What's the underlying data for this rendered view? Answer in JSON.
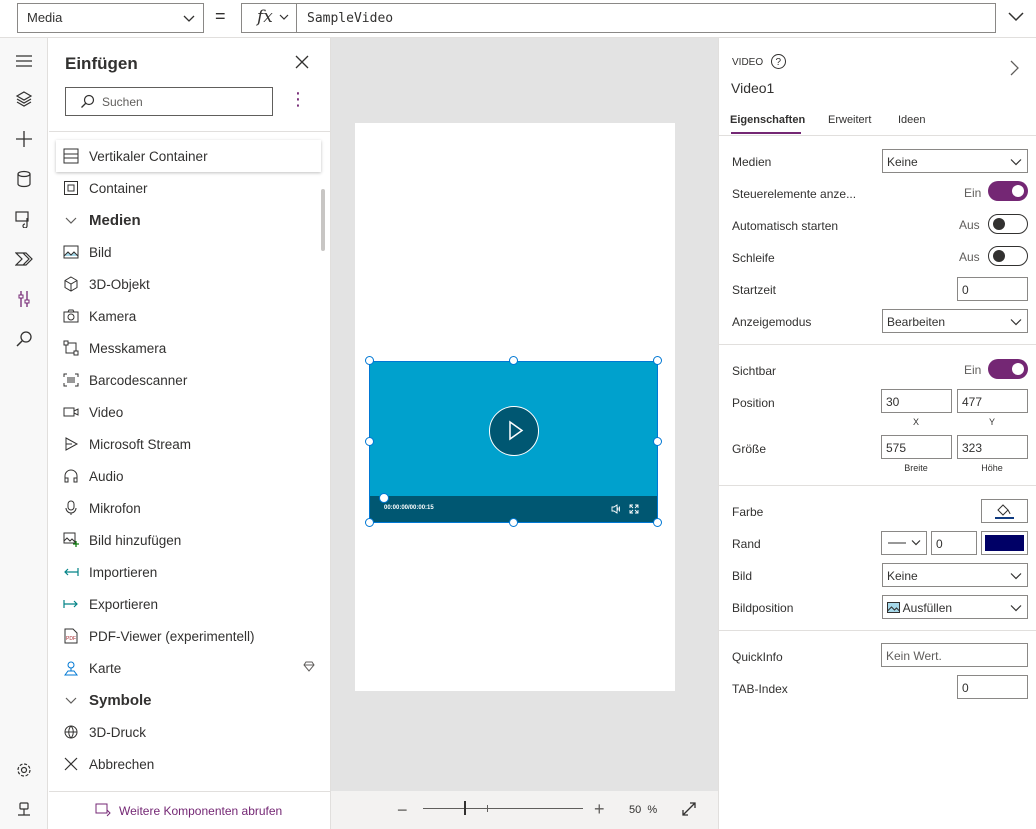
{
  "formula_bar": {
    "property": "Media",
    "formula": "SampleVideo",
    "equals": "=",
    "fx": "fx"
  },
  "left_rail": {
    "icons": [
      "hamburger-icon",
      "layers-icon",
      "plus-icon",
      "data-icon",
      "media-icon",
      "power-automate-icon",
      "tools-icon",
      "search-icon",
      "settings-icon",
      "virtual-agent-icon"
    ]
  },
  "insert_panel": {
    "title": "Einfügen",
    "search_placeholder": "Suchen",
    "more": "⋮",
    "items": [
      {
        "label": "Vertikaler Container",
        "icon": "vertical-container-icon"
      },
      {
        "label": "Container",
        "icon": "container-icon"
      },
      {
        "label": "Medien",
        "icon": "chevron-down-icon"
      },
      {
        "label": "Bild",
        "icon": "image-icon"
      },
      {
        "label": "3D-Objekt",
        "icon": "cube-icon"
      },
      {
        "label": "Kamera",
        "icon": "camera-icon"
      },
      {
        "label": "Messkamera",
        "icon": "measure-camera-icon"
      },
      {
        "label": "Barcodescanner",
        "icon": "barcode-icon"
      },
      {
        "label": "Video",
        "icon": "video-icon"
      },
      {
        "label": "Microsoft Stream",
        "icon": "stream-icon"
      },
      {
        "label": "Audio",
        "icon": "headphones-icon"
      },
      {
        "label": "Mikrofon",
        "icon": "microphone-icon"
      },
      {
        "label": "Bild hinzufügen",
        "icon": "add-image-icon"
      },
      {
        "label": "Importieren",
        "icon": "import-icon"
      },
      {
        "label": "Exportieren",
        "icon": "export-icon"
      },
      {
        "label": "PDF-Viewer (experimentell)",
        "icon": "pdf-icon"
      },
      {
        "label": "Karte",
        "icon": "map-pin-icon"
      },
      {
        "label": "Symbole",
        "icon": "chevron-down-icon"
      },
      {
        "label": "3D-Druck",
        "icon": "3d-print-icon"
      },
      {
        "label": "Abbrechen",
        "icon": "close-icon"
      }
    ],
    "footer_link": "Weitere Komponenten abrufen"
  },
  "canvas": {
    "video_time": "00:00:00/00:00:15",
    "zoom_minus": "−",
    "zoom_plus": "+",
    "zoom_value": "50",
    "zoom_unit": "%",
    "zoom_level": 0.5
  },
  "properties": {
    "control_type": "VIDEO",
    "control_name": "Video1",
    "tabs": [
      "Eigenschaften",
      "Erweitert",
      "Ideen"
    ],
    "medien": {
      "label": "Medien",
      "value": "Keine"
    },
    "steuerelemente": {
      "label": "Steuerelemente anze...",
      "state": "Ein"
    },
    "autostart": {
      "label": "Automatisch starten",
      "state": "Aus"
    },
    "schleife": {
      "label": "Schleife",
      "state": "Aus"
    },
    "startzeit": {
      "label": "Startzeit",
      "value": "0"
    },
    "anzeigemodus": {
      "label": "Anzeigemodus",
      "value": "Bearbeiten"
    },
    "sichtbar": {
      "label": "Sichtbar",
      "state": "Ein"
    },
    "position": {
      "label": "Position",
      "x": "30",
      "y": "477",
      "x_label": "X",
      "y_label": "Y"
    },
    "groesse": {
      "label": "Größe",
      "breite": "575",
      "hoehe": "323",
      "breite_label": "Breite",
      "hoehe_label": "Höhe"
    },
    "farbe": {
      "label": "Farbe",
      "color": "#0f3a80"
    },
    "rand": {
      "label": "Rand",
      "width": "0",
      "color": "#000066"
    },
    "bild": {
      "label": "Bild",
      "value": "Keine"
    },
    "bildposition": {
      "label": "Bildposition",
      "value": "Ausfüllen"
    },
    "quickinfo": {
      "label": "QuickInfo",
      "placeholder": "Kein Wert."
    },
    "tabindex": {
      "label": "TAB-Index",
      "value": "0"
    }
  },
  "colors": {
    "accent": "#742774",
    "video_bg": "#00a1cd",
    "video_bar": "#005772",
    "selection": "#0078d4"
  }
}
